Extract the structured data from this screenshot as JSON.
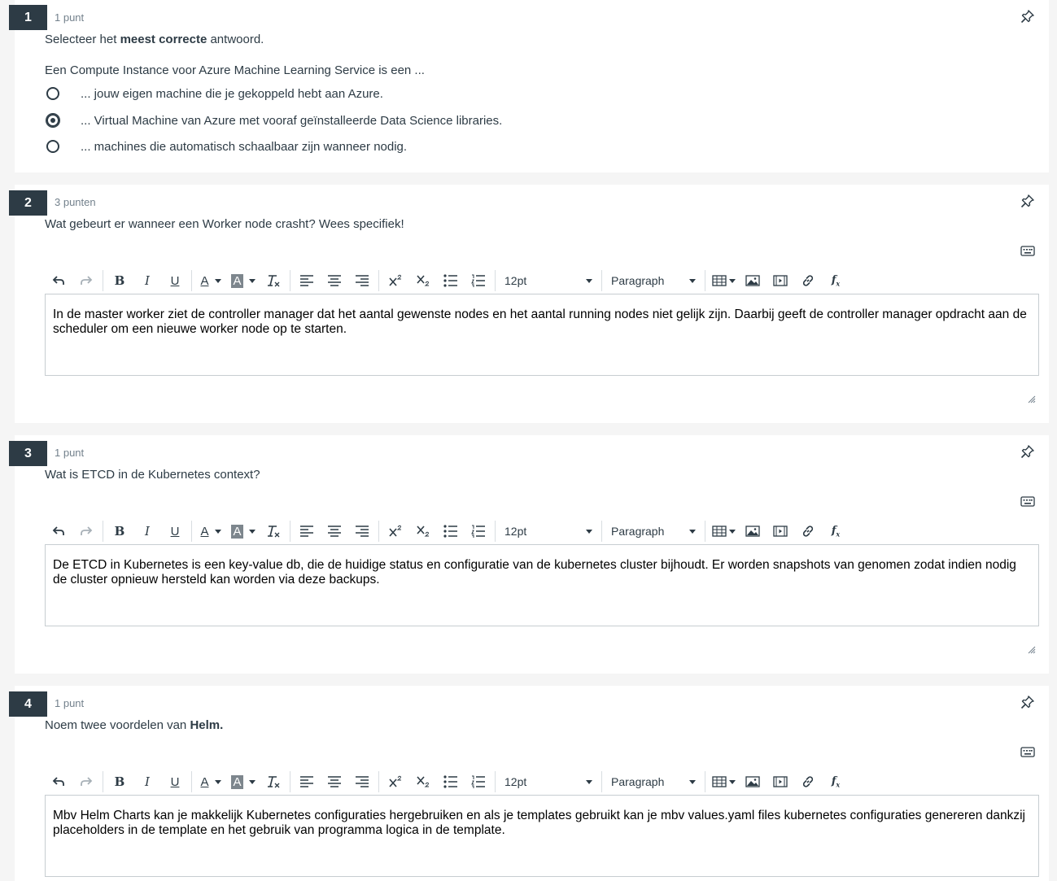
{
  "questions": [
    {
      "number": "1",
      "points": "1 punt",
      "instruction_prefix": "Selecteer het ",
      "instruction_bold": "meest correcte",
      "instruction_suffix": " antwoord.",
      "prompt": "Een Compute Instance voor Azure Machine Learning Service is een ...",
      "options": [
        {
          "label": "... jouw eigen machine die je gekoppeld hebt aan Azure.",
          "selected": false
        },
        {
          "label": "... Virtual Machine van Azure met vooraf geïnstalleerde Data Science libraries.",
          "selected": true
        },
        {
          "label": "... machines die automatisch schaalbaar zijn wanneer nodig.",
          "selected": false
        }
      ]
    },
    {
      "number": "2",
      "points": "3 punten",
      "text": "Wat gebeurt er wanneer een Worker node crasht? Wees specifiek!",
      "answer": "In de master worker ziet de controller manager dat het aantal gewenste nodes en het aantal running nodes niet gelijk zijn. Daarbij geeft de controller manager opdracht aan de scheduler om een nieuwe worker node op te starten."
    },
    {
      "number": "3",
      "points": "1 punt",
      "text": "Wat is ETCD in de Kubernetes context?",
      "answer": "De ETCD in Kubernetes is een key-value db, die de huidige status en configuratie van de kubernetes cluster bijhoudt. Er worden snapshots van genomen zodat indien nodig de cluster opnieuw hersteld kan worden via deze backups."
    },
    {
      "number": "4",
      "points": "1 punt",
      "text_prefix": "Noem twee voordelen van ",
      "text_bold": "Helm.",
      "answer": "Mbv Helm Charts kan je makkelijk Kubernetes configuraties hergebruiken en als je templates gebruikt kan je mbv values.yaml files kubernetes configuraties genereren dankzij placeholders in de template en het gebruik van programma logica in de template."
    }
  ],
  "toolbar": {
    "bold": "B",
    "italic": "I",
    "underline": "U",
    "font_color": "A",
    "highlight": "A",
    "font_size": "12pt",
    "block_format": "Paragraph"
  },
  "colors": {
    "badge": "#2d3b45",
    "text": "#2d3b45",
    "muted": "#73818c",
    "border": "#c7cdd1"
  }
}
